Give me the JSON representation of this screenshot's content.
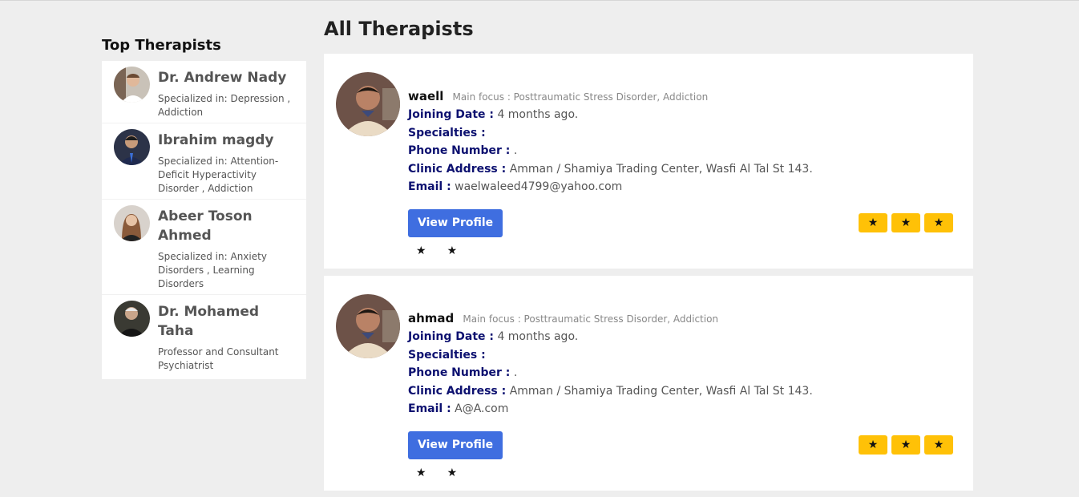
{
  "sidebar": {
    "title": "Top Therapists",
    "items": [
      {
        "name": "Dr. Andrew Nady",
        "spec": "Specialized in: Depression , Addiction"
      },
      {
        "name": "Ibrahim magdy",
        "spec": "Specialized in: Attention-Deficit Hyperactivity Disorder , Addiction"
      },
      {
        "name": "Abeer Toson Ahmed",
        "spec": "Specialized in: Anxiety Disorders , Learning Disorders"
      },
      {
        "name": "Dr. Mohamed Taha",
        "spec": "Professor and Consultant Psychiatrist"
      }
    ]
  },
  "main": {
    "title": "All Therapists",
    "labels": {
      "joining": "Joining Date :",
      "specialties": "Specialties :",
      "phone": "Phone Number :",
      "clinic": "Clinic Address :",
      "email": "Email :",
      "view_profile": "View Profile",
      "star": "★"
    },
    "cards": [
      {
        "name": "waell",
        "focus": "Main focus : Posttraumatic Stress Disorder, Addiction",
        "joining": "4 months ago.",
        "specialties": "",
        "phone": ".",
        "clinic": "Amman / Shamiya Trading Center, Wasfi Al Tal St 143.",
        "email": "waelwaleed4799@yahoo.com"
      },
      {
        "name": "ahmad",
        "focus": "Main focus : Posttraumatic Stress Disorder, Addiction",
        "joining": "4 months ago.",
        "specialties": "",
        "phone": ".",
        "clinic": "Amman / Shamiya Trading Center, Wasfi Al Tal St 143.",
        "email": "A@A.com"
      }
    ]
  },
  "colors": {
    "accent": "#3f6ee0",
    "label": "#0d1170",
    "star_bg": "#ffc107",
    "background": "#eeeeee"
  },
  "icons": {
    "avatar": "person-photo",
    "star": "star-icon"
  }
}
